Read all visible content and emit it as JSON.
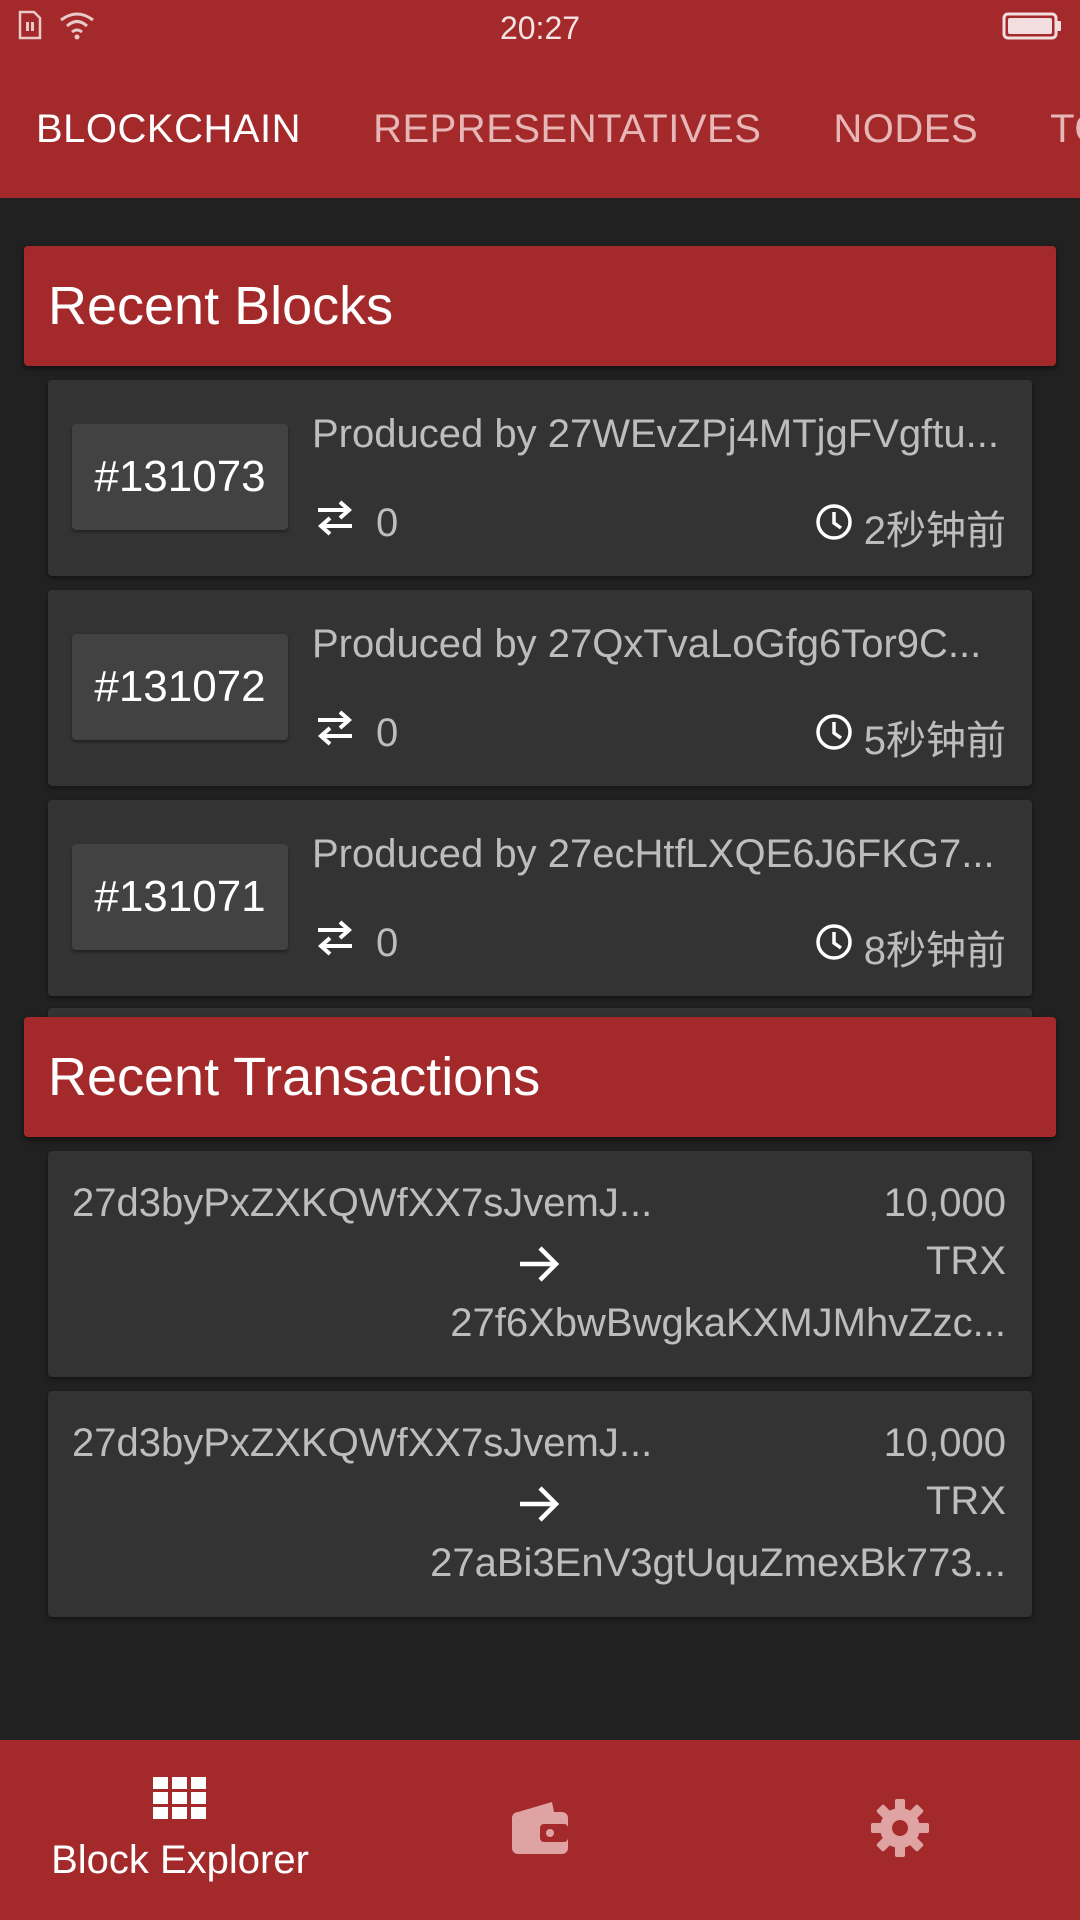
{
  "status_bar": {
    "time": "20:27"
  },
  "tabs": [
    {
      "label": "BLOCKCHAIN",
      "active": true
    },
    {
      "label": "REPRESENTATIVES",
      "active": false
    },
    {
      "label": "NODES",
      "active": false
    },
    {
      "label": "TOK",
      "active": false
    }
  ],
  "recent_blocks": {
    "title": "Recent Blocks",
    "items": [
      {
        "number": "#131073",
        "producer": "Produced by 27WEvZPj4MTjgFVgftu...",
        "tx_count": "0",
        "time_ago": "2秒钟前"
      },
      {
        "number": "#131072",
        "producer": "Produced by 27QxTvaLoGfg6Tor9C...",
        "tx_count": "0",
        "time_ago": "5秒钟前"
      },
      {
        "number": "#131071",
        "producer": "Produced by 27ecHtfLXQE6J6FKG7...",
        "tx_count": "0",
        "time_ago": "8秒钟前"
      }
    ]
  },
  "recent_transactions": {
    "title": "Recent Transactions",
    "items": [
      {
        "from": "27d3byPxZXKQWfXX7sJvemJ...",
        "amount": "10,000",
        "unit": "TRX",
        "to": "27f6XbwBwgkaKXMJMhvZzc..."
      },
      {
        "from": "27d3byPxZXKQWfXX7sJvemJ...",
        "amount": "10,000",
        "unit": "TRX",
        "to": "27aBi3EnV3gtUquZmexBk773..."
      }
    ]
  },
  "bottom_nav": {
    "items": [
      {
        "label": "Block Explorer",
        "icon": "grid-icon",
        "active": true
      },
      {
        "label": "",
        "icon": "wallet-icon",
        "active": false
      },
      {
        "label": "",
        "icon": "gear-icon",
        "active": false
      }
    ]
  },
  "colors": {
    "primary": "#a4292a",
    "background": "#212121",
    "card": "#333333",
    "badge": "#424242",
    "text_secondary": "#bdbdbd",
    "inactive_tab": "#e7b7b7"
  }
}
